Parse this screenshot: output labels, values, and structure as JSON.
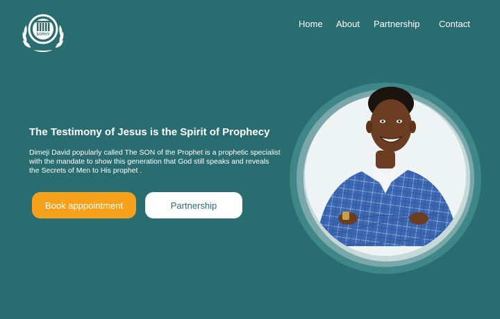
{
  "brand": {
    "logo_text": "SOPHY"
  },
  "nav": {
    "items": [
      "Home",
      "About",
      "Partnership",
      "Contact"
    ]
  },
  "hero": {
    "headline": "The Testimony of Jesus is the Spirit of Prophecy",
    "description": "Dimeji David popularly called The SON of the Prophet is a prophetic specialist with the mandate to show this generation that God still speaks and reveals the Secrets of Men to His prophet .",
    "primary_button": "Book apppointment",
    "secondary_button": "Partnership"
  },
  "colors": {
    "background": "#2a6d70",
    "accent": "#f5a11c",
    "text": "#ffffff"
  }
}
